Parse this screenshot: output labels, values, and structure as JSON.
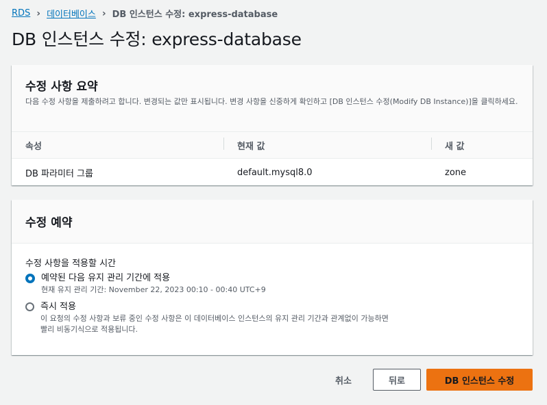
{
  "breadcrumb": {
    "items": [
      "RDS",
      "데이터베이스"
    ],
    "current": "DB 인스턴스 수정: express-database"
  },
  "page_title": "DB 인스턴스 수정: express-database",
  "summary": {
    "title": "수정 사항 요약",
    "description": "다음 수정 사항을 제출하려고 합니다. 변경되는 값만 표시됩니다. 변경 사항을 신중하게 확인하고 [DB 인스턴스 수정(Modify DB Instance)]을 클릭하세요.",
    "columns": [
      "속성",
      "현재 값",
      "새 값"
    ],
    "rows": [
      [
        "DB 파라미터 그룹",
        "default.mysql8.0",
        "zone"
      ]
    ]
  },
  "schedule": {
    "title": "수정 예약",
    "field_label": "수정 사항을 적용할 시간",
    "options": [
      {
        "label": "예약된 다음 유지 관리 기간에 적용",
        "description": "현재 유지 관리 기간: November 22, 2023 00:10 - 00:40 UTC+9",
        "selected": true
      },
      {
        "label": "즉시 적용",
        "description": "이 요청의 수정 사항과 보류 중인 수정 사항은 이 데이터베이스 인스턴스의 유지 관리 기간과 관계없이 가능하면 빨리 비동기식으로 적용됩니다.",
        "selected": false
      }
    ]
  },
  "footer": {
    "cancel": "취소",
    "back": "뒤로",
    "submit": "DB 인스턴스 수정"
  },
  "colors": {
    "primary": "#ec7211",
    "link": "#0073bb"
  }
}
